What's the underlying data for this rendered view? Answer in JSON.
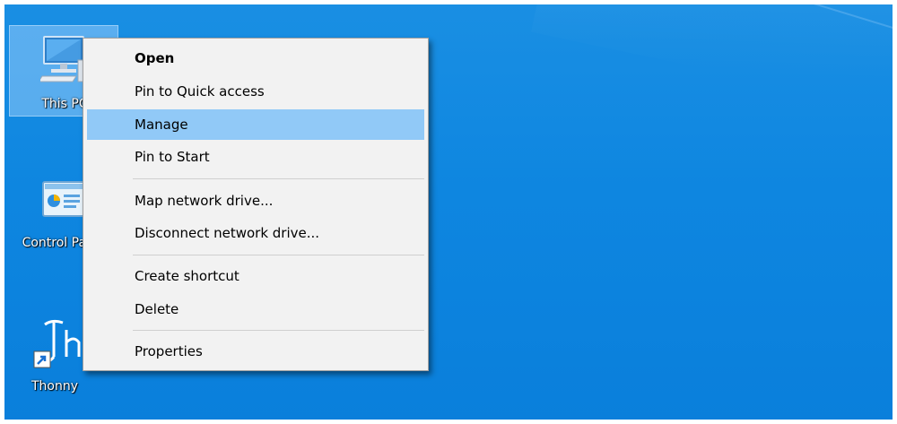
{
  "desktop": {
    "icons": [
      {
        "label": "This PC",
        "icon": "this-pc-icon",
        "selected": true
      },
      {
        "label": "Control Panel",
        "icon": "control-panel-icon",
        "selected": false
      },
      {
        "label": "Thonny",
        "icon": "thonny-icon",
        "selected": false
      }
    ],
    "colors": {
      "wallpaper": "#0e86e0",
      "menu_background": "#f2f2f2",
      "menu_highlight": "#91c9f7"
    }
  },
  "context_menu": {
    "items": [
      {
        "label": "Open",
        "bold": true
      },
      {
        "label": "Pin to Quick access"
      },
      {
        "label": "Manage",
        "highlighted": true
      },
      {
        "label": "Pin to Start"
      },
      {
        "label": "Map network drive..."
      },
      {
        "label": "Disconnect network drive..."
      },
      {
        "label": "Create shortcut"
      },
      {
        "label": "Delete"
      },
      {
        "label": "Properties"
      }
    ]
  }
}
